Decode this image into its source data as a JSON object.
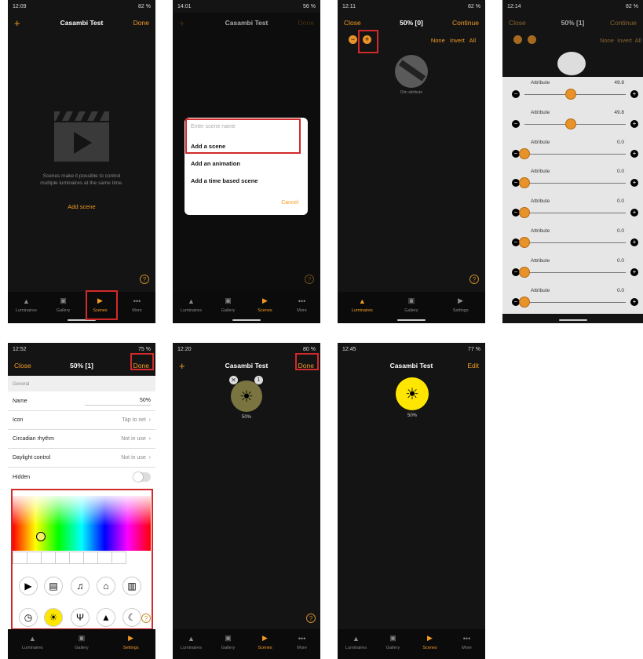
{
  "colors": {
    "accent": "#f29b24",
    "highlight": "#d12a2a",
    "bg": "#141414",
    "sun": "#ffe600"
  },
  "nav": {
    "luminaires": "Luminaires",
    "gallery": "Gallery",
    "scenes": "Scenes",
    "more": "More",
    "settings": "Settings"
  },
  "p1": {
    "time": "12:09",
    "battery": "82 %",
    "add": "+",
    "title": "Casambi Test",
    "done": "Done",
    "empty_text": "Scenes make it possible to control multiple luminaires at the same time.",
    "add_scene": "Add scene"
  },
  "p2": {
    "time": "14:01",
    "battery": "56 %",
    "add": "+",
    "title": "Casambi Test",
    "done": "Done",
    "placeholder": "Enter scene name",
    "opt1": "Add a scene",
    "opt2": "Add an animation",
    "opt3": "Add a time based scene",
    "cancel": "Cancel"
  },
  "p3": {
    "time": "12:11",
    "battery": "82 %",
    "close": "Close",
    "title": "50% [0]",
    "continue": "Continue",
    "none": "None",
    "invert": "Invert",
    "all": "All",
    "fixture_label": "Dim attribute",
    "settings": "Settings"
  },
  "p4": {
    "time": "12:14",
    "battery": "82 %",
    "close": "Close",
    "title": "50% [1]",
    "continue": "Continue",
    "none": "None",
    "invert": "Invert",
    "all": "All",
    "attributes": [
      {
        "label": "Attribute",
        "value": "49.8",
        "pos": 0.46
      },
      {
        "label": "Attribute",
        "value": "49.8",
        "pos": 0.46
      },
      {
        "label": "Attribute",
        "value": "0.0",
        "pos": 0.0
      },
      {
        "label": "Attribute",
        "value": "0.0",
        "pos": 0.0
      },
      {
        "label": "Attribute",
        "value": "0.0",
        "pos": 0.0
      },
      {
        "label": "Attribute",
        "value": "0.0",
        "pos": 0.0
      },
      {
        "label": "Attribute",
        "value": "0.0",
        "pos": 0.0
      },
      {
        "label": "Attribute",
        "value": "0.0",
        "pos": 0.0
      }
    ]
  },
  "p5": {
    "time": "12:52",
    "battery": "75 %",
    "close": "Close",
    "title": "50% [1]",
    "done": "Done",
    "section": "General",
    "name_label": "Name",
    "name_value": "50%",
    "icon_label": "Icon",
    "icon_value": "Tap to set",
    "circ_label": "Circadian rhythm",
    "circ_value": "Not in use",
    "day_label": "Daylight control",
    "day_value": "Not in use",
    "hidden_label": "Hidden"
  },
  "p6": {
    "time": "12:20",
    "battery": "80 %",
    "add": "+",
    "title": "Casambi Test",
    "done": "Done",
    "scene_label": "50%",
    "badge": "1"
  },
  "p7": {
    "time": "12:45",
    "battery": "77 %",
    "title": "Casambi Test",
    "edit": "Edit",
    "scene_label": "50%"
  }
}
